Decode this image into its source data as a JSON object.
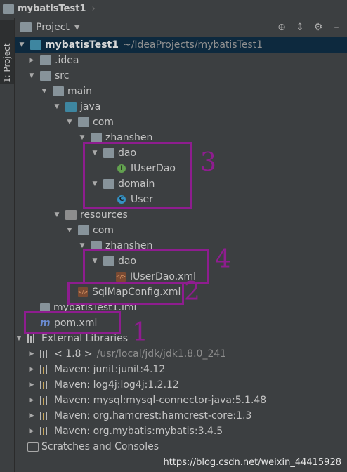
{
  "breadcrumb": {
    "project_name": "mybatisTest1"
  },
  "side_tab": {
    "label": "1: Project"
  },
  "toolbar": {
    "view_label": "Project"
  },
  "tree": {
    "root": {
      "label": "mybatisTest1",
      "path": "~/IdeaProjects/mybatisTest1"
    },
    "idea": ".idea",
    "src": "src",
    "main": "main",
    "java": "java",
    "com": "com",
    "zhanshen": "zhanshen",
    "dao": "dao",
    "iuserdao": "IUserDao",
    "domain": "domain",
    "user": "User",
    "resources": "resources",
    "res_com": "com",
    "res_zhanshen": "zhanshen",
    "res_dao": "dao",
    "iuserdao_xml": "IUserDao.xml",
    "sqlmap": "SqlMapConfig.xml",
    "iml": "mybatisTest1.iml",
    "pom": "pom.xml",
    "ext_libs": "External Libraries",
    "jdk": {
      "label": "< 1.8 >",
      "path": "/usr/local/jdk/jdk1.8.0_241"
    },
    "libs": [
      "Maven: junit:junit:4.12",
      "Maven: log4j:log4j:1.2.12",
      "Maven: mysql:mysql-connector-java:5.1.48",
      "Maven: org.hamcrest:hamcrest-core:1.3",
      "Maven: org.mybatis:mybatis:3.4.5"
    ],
    "scratches": "Scratches and Consoles"
  },
  "annotations": {
    "n1": "1",
    "n2": "2",
    "n3": "3",
    "n4": "4"
  },
  "watermark": "https://blog.csdn.net/weixin_44415928",
  "colors": {
    "background": "#3c3f41",
    "selection": "#0d293e",
    "annotation": "#8e1d8f"
  }
}
